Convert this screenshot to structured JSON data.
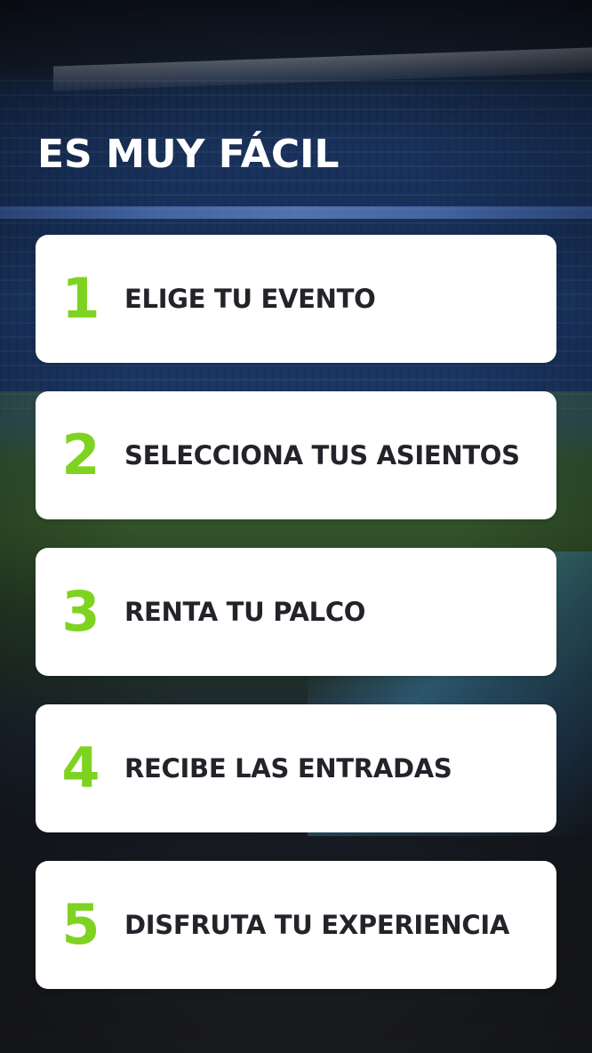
{
  "header": {
    "title": "ES MUY FÁCIL"
  },
  "steps": [
    {
      "number": "1",
      "label": "ELIGE TU EVENTO"
    },
    {
      "number": "2",
      "label": "SELECCIONA TUS ASIENTOS"
    },
    {
      "number": "3",
      "label": "RENTA TU PALCO"
    },
    {
      "number": "4",
      "label": "RECIBE LAS ENTRADAS"
    },
    {
      "number": "5",
      "label": "DISFRUTA TU EXPERIENCIA"
    }
  ],
  "colors": {
    "accent": "#7ed321",
    "card_background": "#ffffff",
    "card_text": "#23242a",
    "title_text": "#ffffff"
  }
}
